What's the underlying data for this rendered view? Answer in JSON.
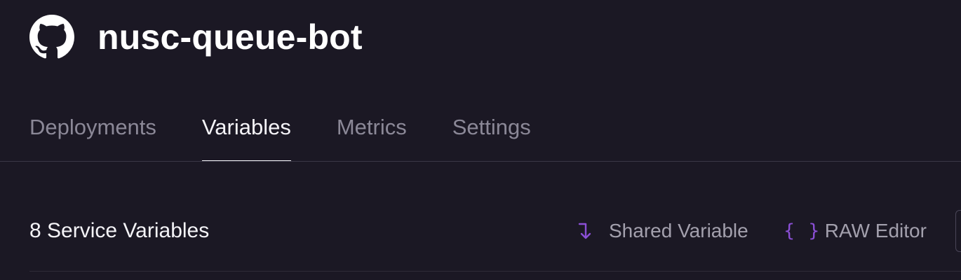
{
  "service": {
    "title": "nusc-queue-bot",
    "icon": "github-icon"
  },
  "tabs": [
    {
      "label": "Deployments",
      "active": false
    },
    {
      "label": "Variables",
      "active": true
    },
    {
      "label": "Metrics",
      "active": false
    },
    {
      "label": "Settings",
      "active": false
    }
  ],
  "variables": {
    "count_label": "8 Service Variables",
    "actions": {
      "shared_variable": {
        "label": "Shared Variable",
        "icon": "arrow-down-right-icon"
      },
      "raw_editor": {
        "label": "RAW Editor",
        "icon": "braces-icon",
        "glyph": "{ }"
      }
    }
  },
  "colors": {
    "background": "#1b1824",
    "accent": "#8b4fd6",
    "tab_inactive": "#8b8897",
    "text": "#f4f3f7"
  }
}
